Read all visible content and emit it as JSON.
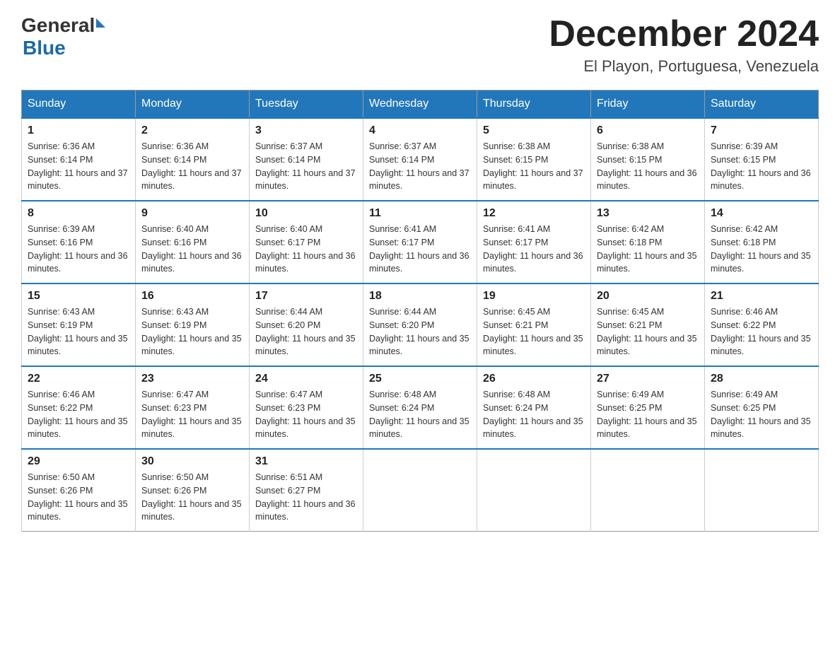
{
  "header": {
    "logo_general": "General",
    "logo_blue": "Blue",
    "month_year": "December 2024",
    "location": "El Playon, Portuguesa, Venezuela"
  },
  "days_of_week": [
    "Sunday",
    "Monday",
    "Tuesday",
    "Wednesday",
    "Thursday",
    "Friday",
    "Saturday"
  ],
  "weeks": [
    [
      {
        "num": "1",
        "sunrise": "6:36 AM",
        "sunset": "6:14 PM",
        "daylight": "11 hours and 37 minutes."
      },
      {
        "num": "2",
        "sunrise": "6:36 AM",
        "sunset": "6:14 PM",
        "daylight": "11 hours and 37 minutes."
      },
      {
        "num": "3",
        "sunrise": "6:37 AM",
        "sunset": "6:14 PM",
        "daylight": "11 hours and 37 minutes."
      },
      {
        "num": "4",
        "sunrise": "6:37 AM",
        "sunset": "6:14 PM",
        "daylight": "11 hours and 37 minutes."
      },
      {
        "num": "5",
        "sunrise": "6:38 AM",
        "sunset": "6:15 PM",
        "daylight": "11 hours and 37 minutes."
      },
      {
        "num": "6",
        "sunrise": "6:38 AM",
        "sunset": "6:15 PM",
        "daylight": "11 hours and 36 minutes."
      },
      {
        "num": "7",
        "sunrise": "6:39 AM",
        "sunset": "6:15 PM",
        "daylight": "11 hours and 36 minutes."
      }
    ],
    [
      {
        "num": "8",
        "sunrise": "6:39 AM",
        "sunset": "6:16 PM",
        "daylight": "11 hours and 36 minutes."
      },
      {
        "num": "9",
        "sunrise": "6:40 AM",
        "sunset": "6:16 PM",
        "daylight": "11 hours and 36 minutes."
      },
      {
        "num": "10",
        "sunrise": "6:40 AM",
        "sunset": "6:17 PM",
        "daylight": "11 hours and 36 minutes."
      },
      {
        "num": "11",
        "sunrise": "6:41 AM",
        "sunset": "6:17 PM",
        "daylight": "11 hours and 36 minutes."
      },
      {
        "num": "12",
        "sunrise": "6:41 AM",
        "sunset": "6:17 PM",
        "daylight": "11 hours and 36 minutes."
      },
      {
        "num": "13",
        "sunrise": "6:42 AM",
        "sunset": "6:18 PM",
        "daylight": "11 hours and 35 minutes."
      },
      {
        "num": "14",
        "sunrise": "6:42 AM",
        "sunset": "6:18 PM",
        "daylight": "11 hours and 35 minutes."
      }
    ],
    [
      {
        "num": "15",
        "sunrise": "6:43 AM",
        "sunset": "6:19 PM",
        "daylight": "11 hours and 35 minutes."
      },
      {
        "num": "16",
        "sunrise": "6:43 AM",
        "sunset": "6:19 PM",
        "daylight": "11 hours and 35 minutes."
      },
      {
        "num": "17",
        "sunrise": "6:44 AM",
        "sunset": "6:20 PM",
        "daylight": "11 hours and 35 minutes."
      },
      {
        "num": "18",
        "sunrise": "6:44 AM",
        "sunset": "6:20 PM",
        "daylight": "11 hours and 35 minutes."
      },
      {
        "num": "19",
        "sunrise": "6:45 AM",
        "sunset": "6:21 PM",
        "daylight": "11 hours and 35 minutes."
      },
      {
        "num": "20",
        "sunrise": "6:45 AM",
        "sunset": "6:21 PM",
        "daylight": "11 hours and 35 minutes."
      },
      {
        "num": "21",
        "sunrise": "6:46 AM",
        "sunset": "6:22 PM",
        "daylight": "11 hours and 35 minutes."
      }
    ],
    [
      {
        "num": "22",
        "sunrise": "6:46 AM",
        "sunset": "6:22 PM",
        "daylight": "11 hours and 35 minutes."
      },
      {
        "num": "23",
        "sunrise": "6:47 AM",
        "sunset": "6:23 PM",
        "daylight": "11 hours and 35 minutes."
      },
      {
        "num": "24",
        "sunrise": "6:47 AM",
        "sunset": "6:23 PM",
        "daylight": "11 hours and 35 minutes."
      },
      {
        "num": "25",
        "sunrise": "6:48 AM",
        "sunset": "6:24 PM",
        "daylight": "11 hours and 35 minutes."
      },
      {
        "num": "26",
        "sunrise": "6:48 AM",
        "sunset": "6:24 PM",
        "daylight": "11 hours and 35 minutes."
      },
      {
        "num": "27",
        "sunrise": "6:49 AM",
        "sunset": "6:25 PM",
        "daylight": "11 hours and 35 minutes."
      },
      {
        "num": "28",
        "sunrise": "6:49 AM",
        "sunset": "6:25 PM",
        "daylight": "11 hours and 35 minutes."
      }
    ],
    [
      {
        "num": "29",
        "sunrise": "6:50 AM",
        "sunset": "6:26 PM",
        "daylight": "11 hours and 35 minutes."
      },
      {
        "num": "30",
        "sunrise": "6:50 AM",
        "sunset": "6:26 PM",
        "daylight": "11 hours and 35 minutes."
      },
      {
        "num": "31",
        "sunrise": "6:51 AM",
        "sunset": "6:27 PM",
        "daylight": "11 hours and 36 minutes."
      },
      null,
      null,
      null,
      null
    ]
  ],
  "labels": {
    "sunrise": "Sunrise:",
    "sunset": "Sunset:",
    "daylight": "Daylight:"
  }
}
